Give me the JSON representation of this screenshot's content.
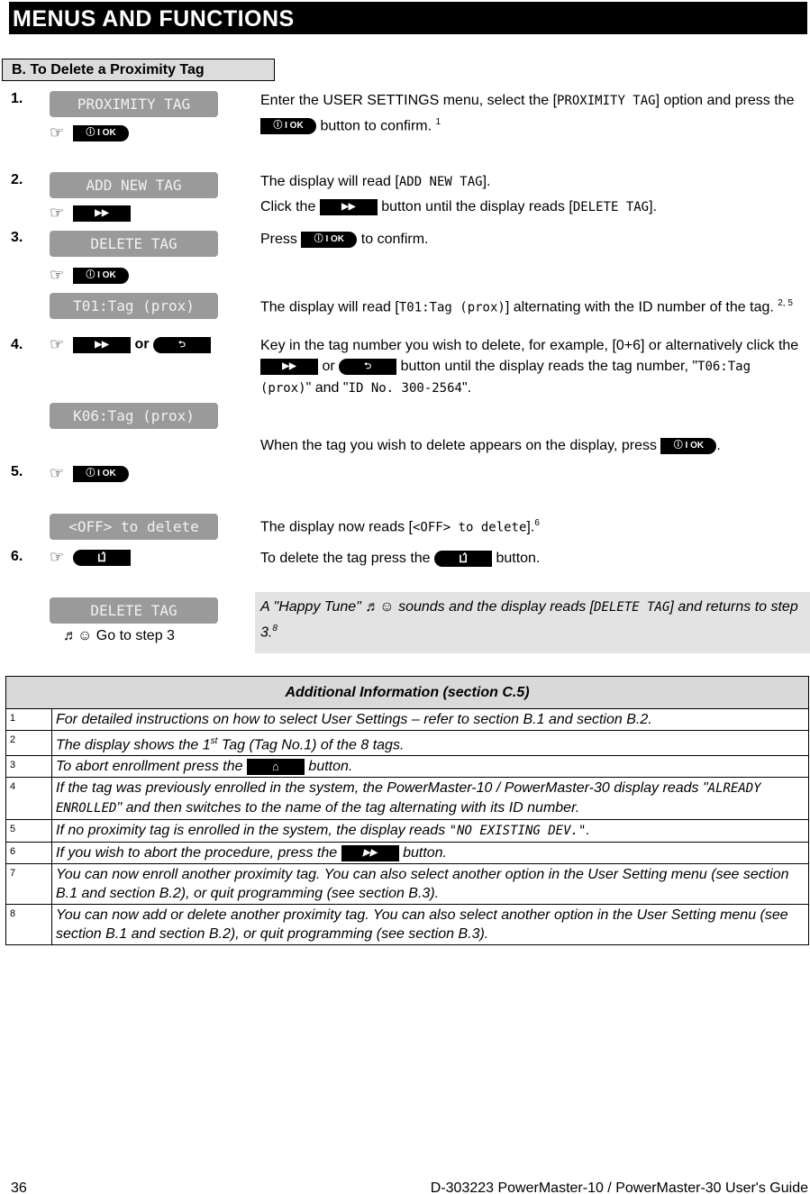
{
  "header": {
    "title": "MENUS AND FUNCTIONS"
  },
  "section": {
    "title": "B. To Delete a Proximity Tag"
  },
  "buttons": {
    "ok": "ⓘ I OK",
    "ff": "▶▶",
    "back": "⮌",
    "lock": "⊔̂",
    "or": "or"
  },
  "icons": {
    "hand": "hand-pointer-icon",
    "ok": "info-ok-button-icon",
    "ff": "fast-forward-button-icon",
    "back": "back-button-icon",
    "lock": "unlock-button-icon",
    "home": "home-button-icon",
    "tune": "music-note-smiley-icon"
  },
  "steps": {
    "s1": {
      "num": "1.",
      "lcd": "PROXIMITY TAG",
      "t1": "Enter the USER SETTINGS menu, select the [",
      "m1": "PROXIMITY TAG",
      "t2": "] option and press the ",
      "t3": " button to confirm. ",
      "sup": "1"
    },
    "s2": {
      "num": "2.",
      "lcd": "ADD NEW TAG",
      "t1": "The display will read [",
      "m1": "ADD NEW TAG",
      "t2": "].",
      "t3": "Click the ",
      "t4": " button until the display reads [",
      "m2": "DELETE TAG",
      "t5": "]."
    },
    "s3": {
      "num": "3.",
      "lcd": "DELETE TAG",
      "t1": "Press ",
      "t2": " to confirm.",
      "lcd2": "T01:Tag (prox)",
      "t3": "The display will read [",
      "m1": "T01:Tag (prox)",
      "t4": "] alternating with the ID number of the tag. ",
      "sup": "2, 5"
    },
    "s4": {
      "num": "4.",
      "t1": "Key in the tag number you wish to delete, for example, [0+6] or alternatively click the ",
      "t2": " or ",
      "t3": " button until the display reads the tag number, \"",
      "m1": "T06:Tag (prox)",
      "t4": "\" and \"",
      "m2": "ID No. 300-2564",
      "t5": "\".",
      "lcd": "K06:Tag (prox)",
      "t6": "When the tag you wish to delete appears on the display, press ",
      "t7": "."
    },
    "s5": {
      "num": "5.",
      "lcd": "<OFF> to delete",
      "t1": "The display now reads [",
      "m1": "<OFF> to delete",
      "t2": "].",
      "sup": "6"
    },
    "s6": {
      "num": "6.",
      "t1": "To delete the tag press the ",
      "t2": " button.",
      "lcd": "DELETE TAG",
      "goto": "♬☺ Go to step 3",
      "r1": "A \"Happy Tune\" ♬☺ sounds and the display reads [",
      "m1": "DELETE TAG",
      "r2": "] and returns to step 3.",
      "sup": "8"
    }
  },
  "info": {
    "title": "Additional Information (section C.5)",
    "rows": [
      {
        "n": "1",
        "text": "For detailed instructions on how to select User Settings – refer to section B.1 and section B.2."
      },
      {
        "n": "2",
        "a": "The display shows the 1",
        "sup": "st",
        "b": " Tag (Tag No.1) of the 8 tags."
      },
      {
        "n": "3",
        "a": "To abort enrollment press the ",
        "b": " button."
      },
      {
        "n": "4",
        "a": "If the tag was previously enrolled in the system, the PowerMaster-10 / PowerMaster-30 display reads \"",
        "m": "ALREADY ENROLLED",
        "b": "\" and then switches to the name of the tag alternating with its ID number."
      },
      {
        "n": "5",
        "a": "If no proximity tag is enrolled in the system, the display reads ",
        "m": "\"NO EXISTING DEV.\"",
        "b": "."
      },
      {
        "n": "6",
        "a": "If you wish to abort the procedure, press the ",
        "b": " button."
      },
      {
        "n": "7",
        "text": "You can now enroll another proximity tag. You can also select another option in the User Setting menu (see section B.1 and section B.2), or quit programming (see section B.3)."
      },
      {
        "n": "8",
        "text": "You can now add or delete another proximity tag. You can also select another option in the User Setting menu (see section B.1 and section B.2), or quit programming (see section B.3)."
      }
    ]
  },
  "footer": {
    "page": "36",
    "doc": "D-303223 PowerMaster-10 / PowerMaster-30 User's Guide"
  }
}
